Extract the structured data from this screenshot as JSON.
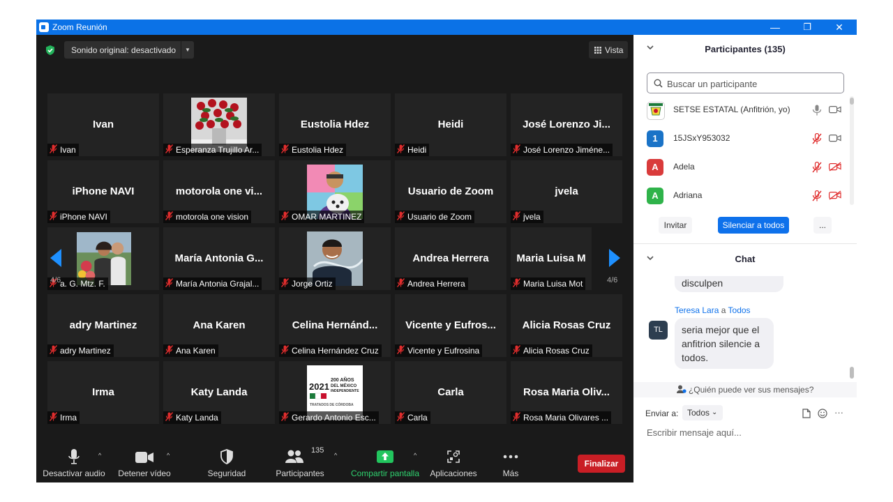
{
  "window": {
    "title": "Zoom Reunión",
    "minimize": "—",
    "restore": "❐",
    "close": "✕"
  },
  "meeting": {
    "sound": "Sonido original: desactivado",
    "sound_caret": "▼",
    "view": "Vista",
    "page_left": "4/6",
    "page_right": "4/6",
    "tiles": [
      {
        "big": "Ivan",
        "label": "Ivan"
      },
      {
        "big": "",
        "label": "Esperanza Trujillo Ar...",
        "photo": "roses"
      },
      {
        "big": "Eustolia Hdez",
        "label": "Eustolia Hdez"
      },
      {
        "big": "Heidi",
        "label": "Heidi"
      },
      {
        "big": "José Lorenzo Ji...",
        "label": "José Lorenzo Jiméne..."
      },
      {
        "big": "iPhone NAVI",
        "label": "iPhone NAVI"
      },
      {
        "big": "motorola one vi...",
        "label": "motorola one vision"
      },
      {
        "big": "",
        "label": "OMAR MARTINEZ",
        "photo": "cartoon-dog"
      },
      {
        "big": "Usuario de Zoom",
        "label": "Usuario de Zoom"
      },
      {
        "big": "jvela",
        "label": "jvela"
      },
      {
        "big": "",
        "label": "a. G. Mtz. F.",
        "photo": "couple"
      },
      {
        "big": "María Antonia G...",
        "label": "María Antonia Grajal..."
      },
      {
        "big": "",
        "label": "Jorge Ortiz",
        "photo": "man"
      },
      {
        "big": "Andrea Herrera",
        "label": "Andrea Herrera"
      },
      {
        "big": "Maria Luisa M",
        "label": "Maria Luisa Mot"
      },
      {
        "big": "adry  Martinez",
        "label": "adry  Martinez"
      },
      {
        "big": "Ana Karen",
        "label": "Ana Karen"
      },
      {
        "big": "Celina  Hernánd...",
        "label": "Celina Hernández Cruz"
      },
      {
        "big": "Vicente y Eufros...",
        "label": "Vicente y Eufrosina"
      },
      {
        "big": "Alicia Rosas Cruz",
        "label": "Alicia Rosas Cruz"
      },
      {
        "big": "Irma",
        "label": "Irma"
      },
      {
        "big": "Katy Landa",
        "label": "Katy Landa"
      },
      {
        "big": "",
        "label": "Gerardo Antonio Esc...",
        "photo": "logo"
      },
      {
        "big": "Carla",
        "label": "Carla"
      },
      {
        "big": "Rosa Maria Oliv...",
        "label": "Rosa Maria Olivares ..."
      }
    ],
    "logo_text": {
      "year": "2021",
      "line1": "200 AÑOS",
      "line2": "DEL MÉXICO",
      "line3": "INDEPENDIENTE",
      "line4": "TRATADOS DE CÓRDOBA"
    }
  },
  "toolbar": {
    "audio": "Desactivar audio",
    "video": "Detener vídeo",
    "security": "Seguridad",
    "participants": "Participantes",
    "participants_count": "135",
    "share": "Compartir pantalla",
    "apps": "Aplicaciones",
    "more": "Más",
    "end": "Finalizar",
    "caret": "^"
  },
  "participants": {
    "title": "Participantes (135)",
    "search_placeholder": "Buscar un participante",
    "list": [
      {
        "name": "SETSE ESTATAL (Anfitrión, yo)",
        "avatar": "",
        "color": "#d8d020"
      },
      {
        "name": "15JSxY953032",
        "avatar": "1",
        "color": "#1a73c7"
      },
      {
        "name": "Adela",
        "avatar": "A",
        "color": "#d93b3b"
      },
      {
        "name": "Adriana",
        "avatar": "A",
        "color": "#2fb34a"
      }
    ],
    "invite": "Invitar",
    "mute_all": "Silenciar a todos",
    "more": "..."
  },
  "chat": {
    "title": "Chat",
    "prev_message": "disculpen",
    "sender": "Teresa Lara",
    "to_word": "a",
    "recipient": "Todos",
    "sender_initials": "TL",
    "message_lines": [
      "seria mejor que el",
      "anfitrion silencie a",
      "todos."
    ],
    "who_can_see": "¿Quién puede ver sus mensajes?",
    "send_to_label": "Enviar a:",
    "send_to_value": "Todos",
    "input_placeholder": "Escribir mensaje aquí...",
    "more": "···"
  },
  "colors": {
    "accent": "#0e71eb",
    "share": "#22c55e",
    "end": "#c91e25",
    "muted": "#e02d2d"
  }
}
